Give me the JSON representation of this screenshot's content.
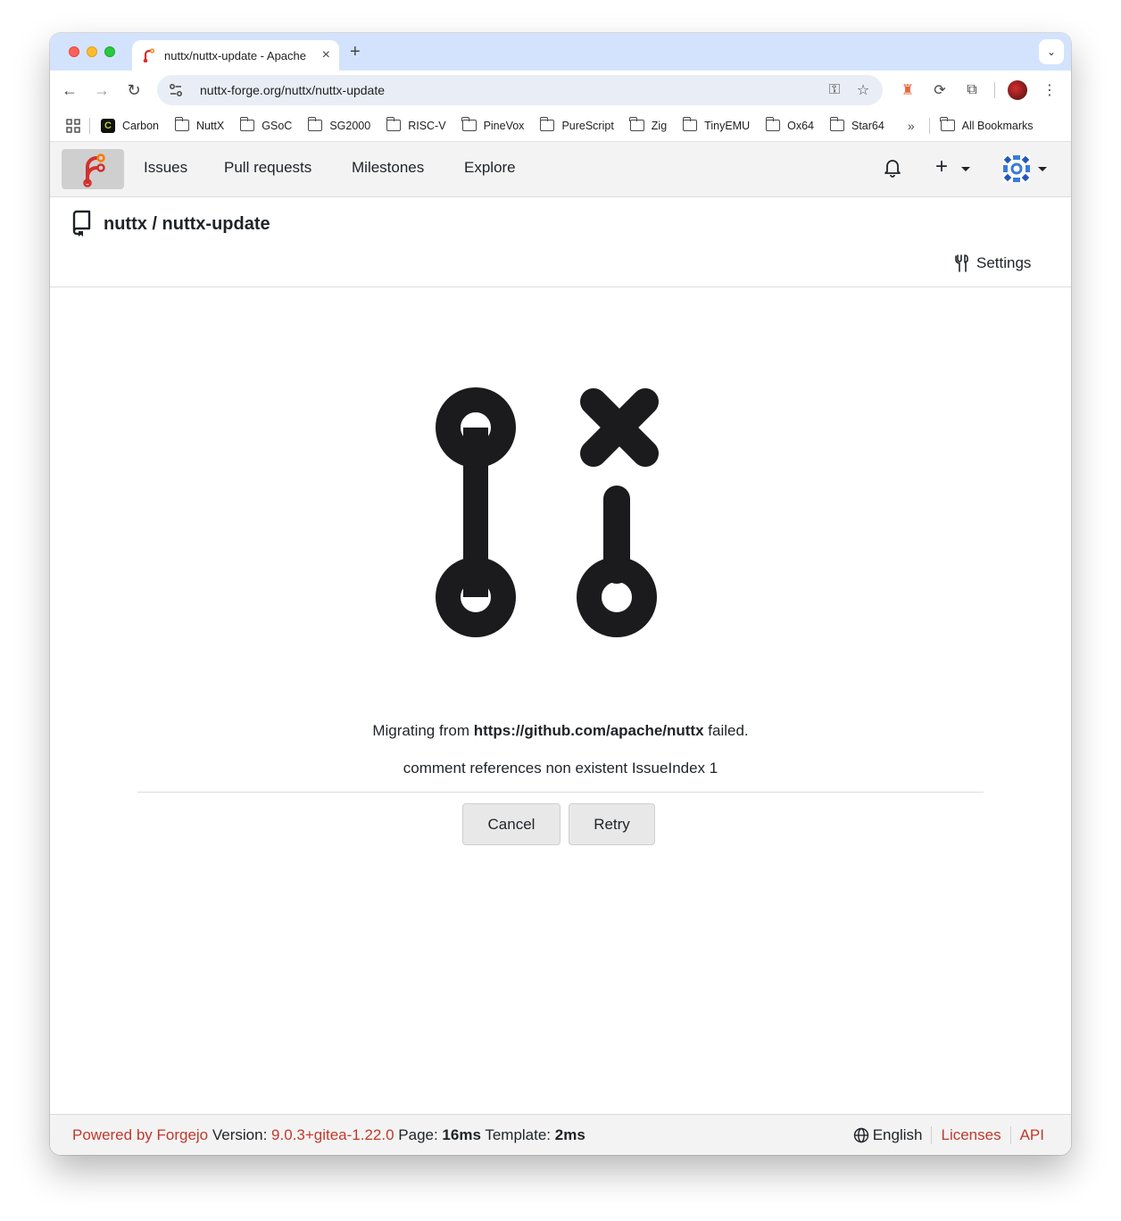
{
  "browser": {
    "tab_title": "nuttx/nuttx-update - Apache",
    "url": "nuttx-forge.org/nuttx/nuttx-update",
    "bookmarks": [
      "Carbon",
      "NuttX",
      "GSoC",
      "SG2000",
      "RISC-V",
      "PineVox",
      "PureScript",
      "Zig",
      "TinyEMU",
      "Ox64",
      "Star64"
    ],
    "all_bookmarks": "All Bookmarks"
  },
  "nav": {
    "issues": "Issues",
    "pulls": "Pull requests",
    "milestones": "Milestones",
    "explore": "Explore"
  },
  "repo": {
    "title": "nuttx / nuttx-update",
    "settings": "Settings"
  },
  "migration": {
    "msg_prefix": "Migrating from ",
    "source_url": "https://github.com/apache/nuttx",
    "msg_suffix": " failed.",
    "error": "comment references non existent IssueIndex 1",
    "cancel": "Cancel",
    "retry": "Retry"
  },
  "footer": {
    "powered": "Powered by Forgejo",
    "version_label": " Version: ",
    "version": "9.0.3+gitea-1.22.0",
    "page_label": " Page: ",
    "page_time": "16ms",
    "template_label": " Template: ",
    "template_time": "2ms",
    "language": "English",
    "licenses": "Licenses",
    "api": "API"
  },
  "colors": {
    "accent": "#c0392b",
    "tabstrip": "#d3e3fd"
  },
  "icons": [
    "forgejo-logo-icon",
    "bell-icon",
    "plus-icon",
    "repo-icon",
    "settings-tools-icon",
    "migration-failed-icon",
    "globe-icon"
  ]
}
